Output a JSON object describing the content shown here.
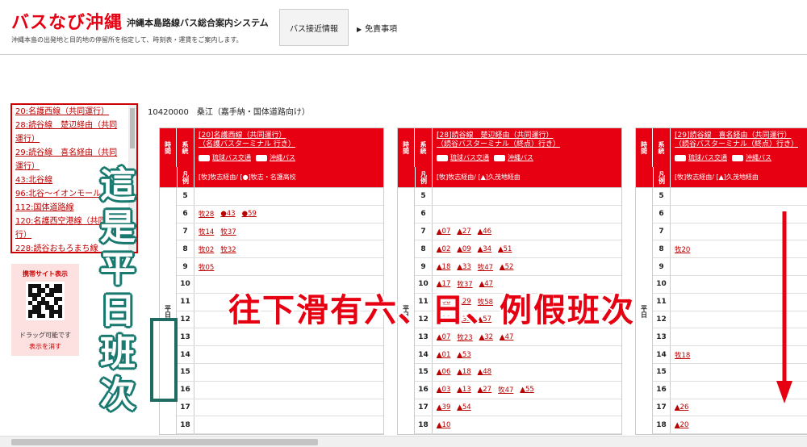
{
  "header": {
    "logo": "バスなび沖縄",
    "subtitle": "沖縄本島路線バス総合案内システム",
    "tagline": "沖縄本島の出発地と目的地の停留所を指定して、時刻表・運賃をご案内します。",
    "approach_button": "バス接近情報",
    "disclaimer_link": "免責事項"
  },
  "route_list": [
    "20:名護西線（共同運行）",
    "28:読谷線　楚辺経由（共同運行）",
    "29:読谷線　喜名経由（共同運行）",
    "43:北谷線",
    "96:北谷〜イオンモール",
    "112:国体道路線",
    "120:名護西空港線（共同運行）",
    "228:読谷おもろまち線"
  ],
  "qr": {
    "title": "携帯サイト表示",
    "drag": "ドラッグ可能です",
    "hide": "表示を消す"
  },
  "stop_name": "10420000　桑江（嘉手納・国体道路向け）",
  "column_labels": {
    "jikan": "時間",
    "keito": "系統",
    "hanrei": "凡例",
    "day": "平日"
  },
  "timetables": [
    {
      "route_title_1": "[20]名護西線（共同運行）",
      "route_title_2": "（名護バスターミナル 行き）",
      "company_1": "琉球バス交通",
      "company_2": "沖縄バス",
      "legend": "[牧]牧志経由/ [●]牧志・名護高校",
      "rows": [
        {
          "hour": "5",
          "mins": []
        },
        {
          "hour": "6",
          "mins": [
            "牧28",
            "●43",
            "●59"
          ]
        },
        {
          "hour": "7",
          "mins": [
            "牧14",
            "牧37"
          ]
        },
        {
          "hour": "8",
          "mins": [
            "牧02",
            "牧32"
          ]
        },
        {
          "hour": "9",
          "mins": [
            "牧05"
          ]
        },
        {
          "hour": "10",
          "mins": []
        },
        {
          "hour": "11",
          "mins": []
        },
        {
          "hour": "12",
          "mins": []
        },
        {
          "hour": "13",
          "mins": []
        },
        {
          "hour": "14",
          "mins": []
        },
        {
          "hour": "15",
          "mins": []
        },
        {
          "hour": "16",
          "mins": []
        },
        {
          "hour": "17",
          "mins": []
        },
        {
          "hour": "18",
          "mins": []
        }
      ]
    },
    {
      "route_title_1": "[28]読谷線　楚辺経由（共同運行）",
      "route_title_2": "（読谷バスターミナル（終点）行き）",
      "company_1": "琉球バス交通",
      "company_2": "沖縄バス",
      "legend": "[牧]牧志経由/ [▲]久茂地経由",
      "rows": [
        {
          "hour": "5",
          "mins": []
        },
        {
          "hour": "6",
          "mins": []
        },
        {
          "hour": "7",
          "mins": [
            "▲07",
            "▲27",
            "▲46"
          ]
        },
        {
          "hour": "8",
          "mins": [
            "▲02",
            "▲09",
            "▲34",
            "▲51"
          ]
        },
        {
          "hour": "9",
          "mins": [
            "▲18",
            "▲33",
            "牧47",
            "▲52"
          ]
        },
        {
          "hour": "10",
          "mins": [
            "▲17",
            "牧37",
            "▲47"
          ]
        },
        {
          "hour": "11",
          "mins": [
            "▲08",
            "▲29",
            "牧58"
          ]
        },
        {
          "hour": "12",
          "mins": [
            "▲18",
            "▲39",
            "▲57"
          ]
        },
        {
          "hour": "13",
          "mins": [
            "▲07",
            "牧23",
            "▲32",
            "▲47"
          ]
        },
        {
          "hour": "14",
          "mins": [
            "▲01",
            "▲53"
          ]
        },
        {
          "hour": "15",
          "mins": [
            "▲06",
            "▲18",
            "▲48"
          ]
        },
        {
          "hour": "16",
          "mins": [
            "▲03",
            "▲13",
            "▲27",
            "牧47",
            "▲55"
          ]
        },
        {
          "hour": "17",
          "mins": [
            "▲39",
            "▲54"
          ]
        },
        {
          "hour": "18",
          "mins": [
            "▲10"
          ]
        }
      ]
    },
    {
      "route_title_1": "[29]読谷線　喜名経由（共同運行）",
      "route_title_2": "（読谷バスターミナル（終点）行き）",
      "company_1": "琉球バス交通",
      "company_2": "沖縄バス",
      "legend": "[牧]牧志経由/ [▲]久茂地経由",
      "rows": [
        {
          "hour": "5",
          "mins": []
        },
        {
          "hour": "6",
          "mins": []
        },
        {
          "hour": "7",
          "mins": []
        },
        {
          "hour": "8",
          "mins": [
            "牧20"
          ]
        },
        {
          "hour": "9",
          "mins": []
        },
        {
          "hour": "10",
          "mins": []
        },
        {
          "hour": "11",
          "mins": []
        },
        {
          "hour": "12",
          "mins": []
        },
        {
          "hour": "13",
          "mins": []
        },
        {
          "hour": "14",
          "mins": [
            "牧18"
          ]
        },
        {
          "hour": "15",
          "mins": []
        },
        {
          "hour": "16",
          "mins": []
        },
        {
          "hour": "17",
          "mins": [
            "▲26"
          ]
        },
        {
          "hour": "18",
          "mins": [
            "▲20"
          ]
        }
      ]
    }
  ],
  "overlay": {
    "vertical_text": "這是平日班次",
    "horizontal_text": "往下滑有六、日、例假班次"
  },
  "colors": {
    "brand_red": "#e60012",
    "overlay_teal": "#1f6b62"
  }
}
